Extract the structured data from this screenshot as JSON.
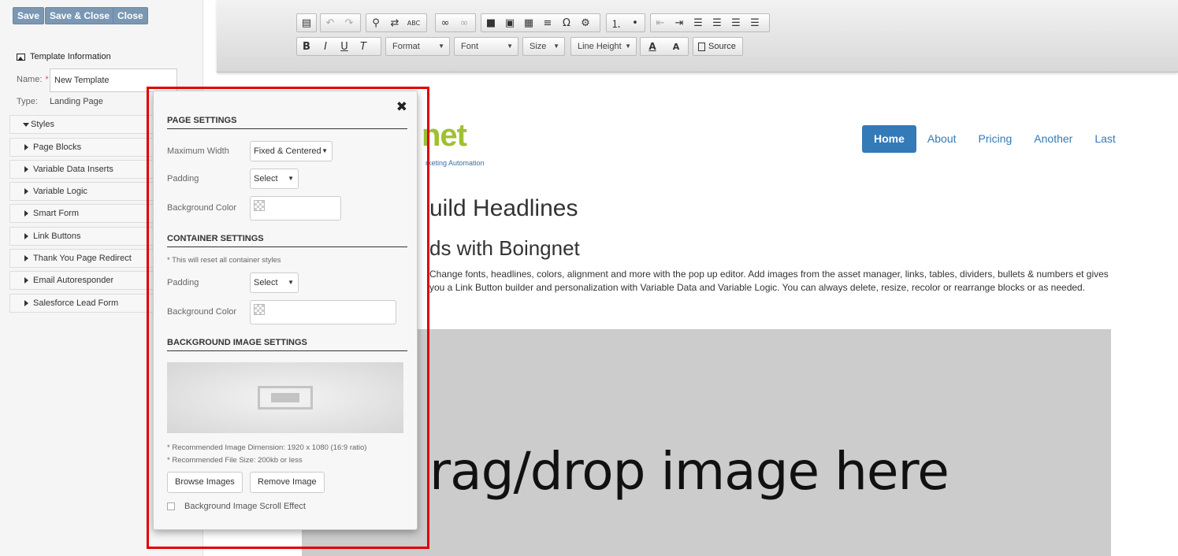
{
  "sidebar": {
    "buttons": {
      "save": "Save",
      "save_close": "Save & Close",
      "close": "Close"
    },
    "template_info_title": "Template Information",
    "name_label": "Name:",
    "name_required": "*",
    "name_value": "New Template",
    "type_label": "Type:",
    "type_value": "Landing Page",
    "items": [
      {
        "label": "Styles",
        "expanded": true
      },
      {
        "label": "Page Blocks"
      },
      {
        "label": "Variable Data Inserts"
      },
      {
        "label": "Variable Logic"
      },
      {
        "label": "Smart Form"
      },
      {
        "label": "Link Buttons"
      },
      {
        "label": "Thank You Page Redirect"
      },
      {
        "label": "Email Autoresponder"
      },
      {
        "label": "Salesforce Lead Form"
      }
    ]
  },
  "toolbar": {
    "format": "Format",
    "font": "Font",
    "size": "Size",
    "line_height": "Line Height",
    "source": "Source",
    "bold": "B",
    "italic": "I",
    "underline": "U",
    "remove_format": "T",
    "text_color": "A",
    "bg_color": "A"
  },
  "canvas": {
    "brand": "net",
    "brand_tagline": "rketing Automation",
    "nav": [
      "Home",
      "About",
      "Pricing",
      "Another",
      "Last"
    ],
    "headline1": "uild Headlines",
    "headline2": "ds with Boingnet",
    "body_text": "Change fonts, headlines, colors, alignment and more with the pop up editor. Add images from the asset manager, links, tables, dividers, bullets & numbers et gives you a Link Button builder and personalization with Variable Data and Variable Logic. You can always delete, resize, recolor or rearrange blocks or as needed.",
    "drop_text": "rag/drop image here"
  },
  "modal": {
    "page_settings_title": "PAGE SETTINGS",
    "max_width_label": "Maximum Width",
    "max_width_value": "Fixed & Centered",
    "padding_label": "Padding",
    "padding_value": "Select",
    "bg_color_label": "Background Color",
    "container_settings_title": "CONTAINER SETTINGS",
    "container_note": "* This will reset all container styles",
    "container_padding_label": "Padding",
    "container_padding_value": "Select",
    "container_bg_color_label": "Background Color",
    "bg_image_title": "BACKGROUND IMAGE SETTINGS",
    "rec_dimension": "* Recommended Image Dimension: 1920 x 1080 (16:9 ratio)",
    "rec_file_size": "* Recommended File Size: 200kb or less",
    "browse_button": "Browse Images",
    "remove_button": "Remove Image",
    "scroll_effect_label": "Background Image Scroll Effect"
  },
  "colors": {
    "highlight": "#e00000",
    "nav_active": "#337ab7",
    "brand_green": "#9fc031",
    "sidebar_buttons": "#7a97b3"
  }
}
